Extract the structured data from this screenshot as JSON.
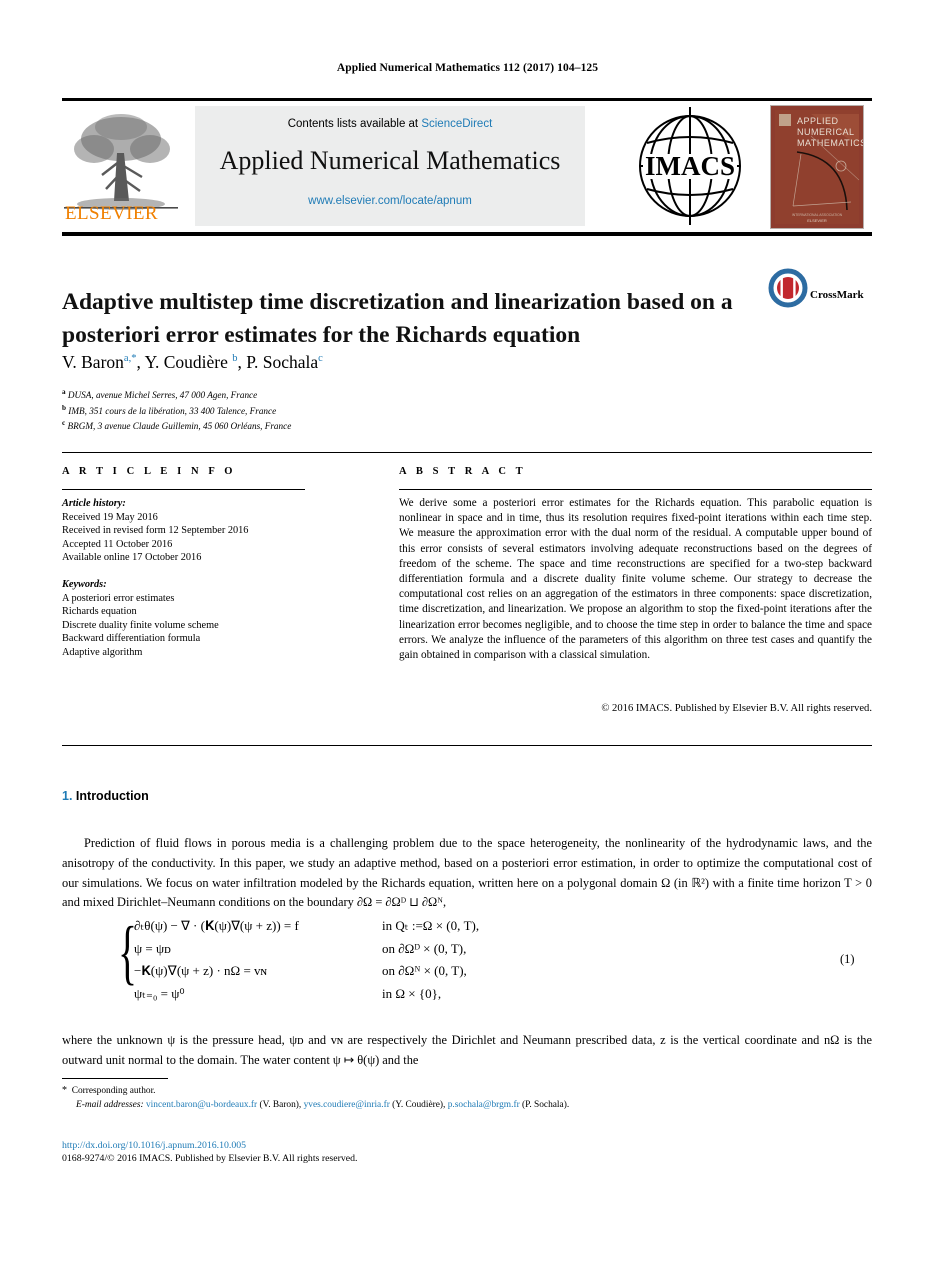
{
  "running_head": "Applied Numerical Mathematics 112 (2017) 104–125",
  "masthead": {
    "contents_prefix": "Contents lists available at ",
    "sciencedirect": "ScienceDirect",
    "journal_title": "Applied Numerical Mathematics",
    "journal_url": "www.elsevier.com/locate/apnum",
    "publisher_wordmark": "ELSEVIER",
    "society_logo_text": "IMACS",
    "cover_lines": [
      "APPLIED",
      "NUMERICAL",
      "MATHEMATICS"
    ],
    "link_color": "#1f7bb6"
  },
  "article": {
    "title": "Adaptive multistep time discretization and linearization based on a posteriori error estimates for the Richards equation",
    "crossmark_label": "CrossMark",
    "authors": [
      {
        "name": "V. Baron",
        "marks": "a,*"
      },
      {
        "name": "Y. Coudière",
        "marks": "b"
      },
      {
        "name": "P. Sochala",
        "marks": "c"
      }
    ],
    "affiliations": [
      {
        "mark": "a",
        "text": "DUSA, avenue Michel Serres, 47 000 Agen, France"
      },
      {
        "mark": "b",
        "text": "IMB, 351 cours de la libération, 33 400 Talence, France"
      },
      {
        "mark": "c",
        "text": "BRGM, 3 avenue Claude Guillemin, 45 060 Orléans, France"
      }
    ]
  },
  "info": {
    "heading": "A R T I C L E    I N F O",
    "history_label": "Article history:",
    "history": [
      "Received 19 May 2016",
      "Received in revised form 12 September 2016",
      "Accepted 11 October 2016",
      "Available online 17 October 2016"
    ],
    "keywords_label": "Keywords:",
    "keywords": [
      "A posteriori error estimates",
      "Richards equation",
      "Discrete duality finite volume scheme",
      "Backward differentiation formula",
      "Adaptive algorithm"
    ]
  },
  "abstract": {
    "heading": "A B S T R A C T",
    "text": "We derive some a posteriori error estimates for the Richards equation. This parabolic equation is nonlinear in space and in time, thus its resolution requires fixed-point iterations within each time step. We measure the approximation error with the dual norm of the residual. A computable upper bound of this error consists of several estimators involving adequate reconstructions based on the degrees of freedom of the scheme. The space and time reconstructions are specified for a two-step backward differentiation formula and a discrete duality finite volume scheme. Our strategy to decrease the computational cost relies on an aggregation of the estimators in three components: space discretization, time discretization, and linearization. We propose an algorithm to stop the fixed-point iterations after the linearization error becomes negligible, and to choose the time step in order to balance the time and space errors. We analyze the influence of the parameters of this algorithm on three test cases and quantify the gain obtained in comparison with a classical simulation.",
    "copyright": "© 2016 IMACS. Published by Elsevier B.V. All rights reserved."
  },
  "body": {
    "section_number": "1.",
    "section_title": "Introduction",
    "paragraph_1": "Prediction of fluid flows in porous media is a challenging problem due to the space heterogeneity, the nonlinearity of the hydrodynamic laws, and the anisotropy of the conductivity. In this paper, we study an adaptive method, based on a posteriori error estimation, in order to optimize the computational cost of our simulations. We focus on water infiltration modeled by the Richards equation, written here on a polygonal domain Ω (in ℝ²) with a finite time horizon T > 0 and mixed Dirichlet–Neumann conditions on the boundary ∂Ω = ∂Ωᴰ ⊔ ∂Ωᴺ,",
    "equation": {
      "number": "(1)",
      "rows": [
        {
          "lhs": "∂ₜθ(ψ) − ∇ · (𝐊(ψ)∇(ψ + z)) = f",
          "rhs": "in Qₜ :=Ω × (0, T),"
        },
        {
          "lhs": "ψ = ψᴅ",
          "rhs": "on ∂Ωᴰ × (0, T),"
        },
        {
          "lhs": "−𝐊(ψ)∇(ψ + z) · nΩ = vɴ",
          "rhs": "on ∂Ωᴺ × (0, T),"
        },
        {
          "lhs": "ψₜ₌₀ = ψ⁰",
          "rhs": "in Ω × {0},"
        }
      ]
    },
    "paragraph_2": "where the unknown ψ is the pressure head, ψᴅ and vɴ are respectively the Dirichlet and Neumann prescribed data, z is the vertical coordinate and nΩ is the outward unit normal to the domain. The water content ψ ↦ θ(ψ) and the"
  },
  "footer": {
    "corresponding_author": "Corresponding author.",
    "email_label": "E-mail addresses:",
    "emails": [
      {
        "address": "vincent.baron@u-bordeaux.fr",
        "person": "(V. Baron),"
      },
      {
        "address": "yves.coudiere@inria.fr",
        "person": "(Y. Coudière),"
      },
      {
        "address": "p.sochala@brgm.fr",
        "person": "(P. Sochala)."
      }
    ],
    "doi": "http://dx.doi.org/10.1016/j.apnum.2016.10.005",
    "issn_line": "0168-9274/© 2016 IMACS. Published by Elsevier B.V. All rights reserved."
  }
}
